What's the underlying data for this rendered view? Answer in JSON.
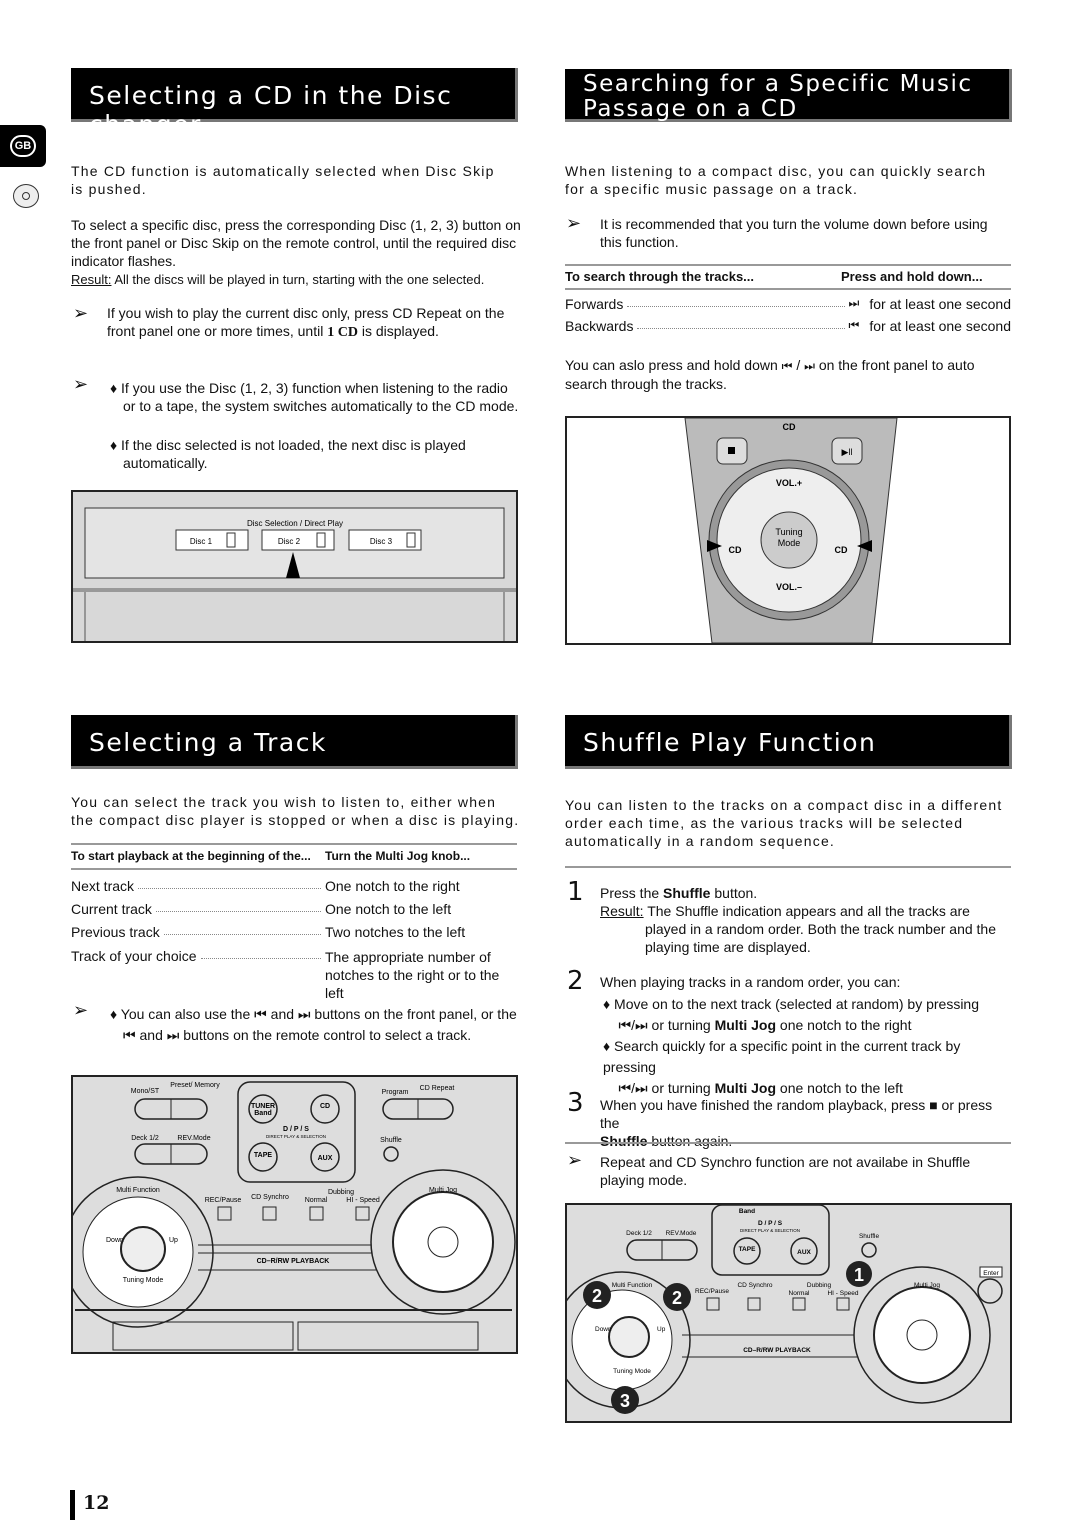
{
  "side": {
    "lang_badge": "GB",
    "icon": "cd-icon"
  },
  "s1": {
    "title": "Selecting a CD in the Disc changer",
    "p1": "The CD function is automatically selected when Disc Skip is pushed.",
    "p2": "To select a specific disc, press the corresponding Disc (1, 2, 3) button on the front panel or Disc Skip on the remote control, until the required disc indicator flashes.",
    "result_label": "Result:",
    "result": "All the discs will be played in turn, starting with the one selected.",
    "note1a": "If you wish to play the current disc only, press CD Repeat on the front panel one or more times, until ",
    "note1b": "1 CD",
    "note1c": " is displayed.",
    "bullet1": "If you use the Disc (1, 2, 3) function when listening to the radio or to a tape, the system switches automatically to the CD mode.",
    "bullet2": "If the disc selected is not loaded, the next disc is played automatically.",
    "fig": {
      "label": "Disc Selection / Direct Play",
      "discs": [
        "Disc 1",
        "Disc 2",
        "Disc 3"
      ]
    }
  },
  "s2": {
    "title_1": "Searching for a Specific Music",
    "title_2": "Passage on a CD",
    "p1": "When listening to a compact disc, you can quickly search for a specific music passage on a track.",
    "note": "It is recommended that you turn the volume down before using this function.",
    "th1": "To search through the tracks...",
    "th2": "Press and hold down...",
    "rows": [
      {
        "label": "Forwards",
        "icon": "next-track-icon",
        "glyph": "⏭",
        "value": "for at least one second"
      },
      {
        "label": "Backwards",
        "icon": "prev-track-icon",
        "glyph": "⏮",
        "value": "for at least one second"
      }
    ],
    "p2a": "You can aslo press and hold down ",
    "p2b": " / ",
    "p2c": " on the front panel to auto search through the tracks.",
    "fig": {
      "cd": "CD",
      "vol_up": "VOL.+",
      "vol_down": "VOL.–",
      "tuning": "Tuning",
      "mode": "Mode",
      "cd_left": "CD",
      "cd_right": "CD"
    }
  },
  "s3": {
    "title": "Selecting a Track",
    "p1": "You can select the track you wish to listen to, either when the compact disc player is stopped or when a disc is playing.",
    "th1": "To start playback at the beginning of the...",
    "th2": "Turn the Multi Jog knob...",
    "rows": [
      {
        "label": "Next track",
        "value": "One notch to the right"
      },
      {
        "label": "Current track",
        "value": "One notch to the left"
      },
      {
        "label": "Previous track",
        "value": "Two notches to the left"
      },
      {
        "label": "Track of your choice",
        "value": "The appropriate number of notches to the right or to the left"
      }
    ],
    "note_a": "You can also use the ",
    "note_b": " and ",
    "note_c": " buttons on the front panel, or the ",
    "note_d": " and ",
    "note_e": " buttons on the remote control to select a track.",
    "fig": {
      "mono": "Mono/ST",
      "preset": "Preset/ Memory",
      "program": "Program",
      "cd_repeat": "CD Repeat",
      "tuner": "TUNER",
      "band": "Band",
      "cd": "CD",
      "dps": "D / P / S",
      "dps_sub": "DIRECT PLAY & SELECTION",
      "tape": "TAPE",
      "aux": "AUX",
      "deck": "Deck 1/2",
      "rev": "REV.Mode",
      "shuffle": "Shuffle",
      "multi_function": "Multi Function",
      "rec": "REC/Pause",
      "synchro": "CD Synchro",
      "dubbing": "Dubbing",
      "normal": "Normal",
      "hispeed": "HI - Speed",
      "multi_jog": "Multi Jog",
      "down": "Down",
      "up": "Up",
      "tuning_mode": "Tuning Mode",
      "playback": "CD–R/RW PLAYBACK"
    }
  },
  "s4": {
    "title": "Shuffle Play Function",
    "p1": "You can listen to the tracks on a compact disc in a different order each time, as the various tracks will be selected automatically in a random sequence.",
    "steps": [
      {
        "n": "1",
        "a": "Press the ",
        "b": "Shuffle",
        "c": " button.",
        "result_label": "Result:",
        "result": "The Shuffle indication appears and all the tracks are played in a random order. Both the track number and the playing time are displayed."
      },
      {
        "n": "2",
        "a": "When playing tracks in a random order, you can:",
        "b1": "Move on to the next track (selected at random) by pressing",
        "b1c": " or turning ",
        "b1d": "Multi Jog",
        "b1e": " one notch to the right",
        "b2": "Search quickly for a specific point in the current track by pressing",
        "b2c": " or turning ",
        "b2d": "Multi Jog",
        "b2e": " one notch to the left"
      },
      {
        "n": "3",
        "a": "When you have finished the random playback, press ",
        "c": " or press the ",
        "b": "Shuffle",
        "d": " button again."
      }
    ],
    "note": "Repeat and CD Synchro function are not availabe in Shuffle playing mode.",
    "fig": {
      "band": "Band",
      "dps": "D / P / S",
      "dps_sub": "DIRECT PLAY & SELECTION",
      "deck": "Deck 1/2",
      "rev": "REV.Mode",
      "tape": "TAPE",
      "aux": "AUX",
      "shuffle": "Shuffle",
      "enter": "Enter",
      "multi_function": "Multi Function",
      "rec": "REC/Pause",
      "synchro": "CD Synchro",
      "dubbing": "Dubbing",
      "normal": "Normal",
      "hispeed": "HI - Speed",
      "multi_jog": "Multi Jog",
      "down": "Down",
      "up": "Up",
      "tuning_mode": "Tuning Mode",
      "playback": "CD–R/RW PLAYBACK",
      "callouts": [
        "1",
        "2",
        "2",
        "3"
      ]
    }
  },
  "page_number": "12"
}
